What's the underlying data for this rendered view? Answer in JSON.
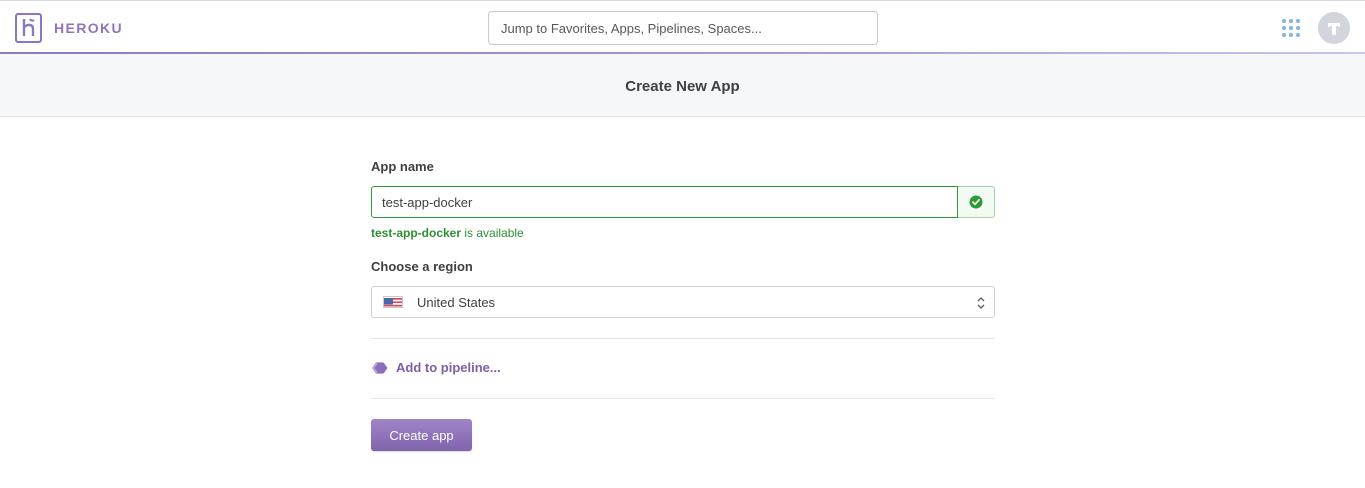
{
  "header": {
    "brand": "HEROKU",
    "search_placeholder": "Jump to Favorites, Apps, Pipelines, Spaces...",
    "apps_icon": "apps-grid-icon",
    "avatar_icon": "user-avatar-icon"
  },
  "page": {
    "title": "Create New App"
  },
  "form": {
    "app_name_label": "App name",
    "app_name_value": "test-app-docker",
    "availability_name": "test-app-docker",
    "availability_suffix": " is available",
    "region_label": "Choose a region",
    "region_value": "United States",
    "pipeline_link": "Add to pipeline...",
    "create_button": "Create app"
  },
  "colors": {
    "brand": "#8d76bd",
    "success": "#2f9a3a",
    "button": "#8f72ba",
    "link": "#7c5fa8"
  }
}
